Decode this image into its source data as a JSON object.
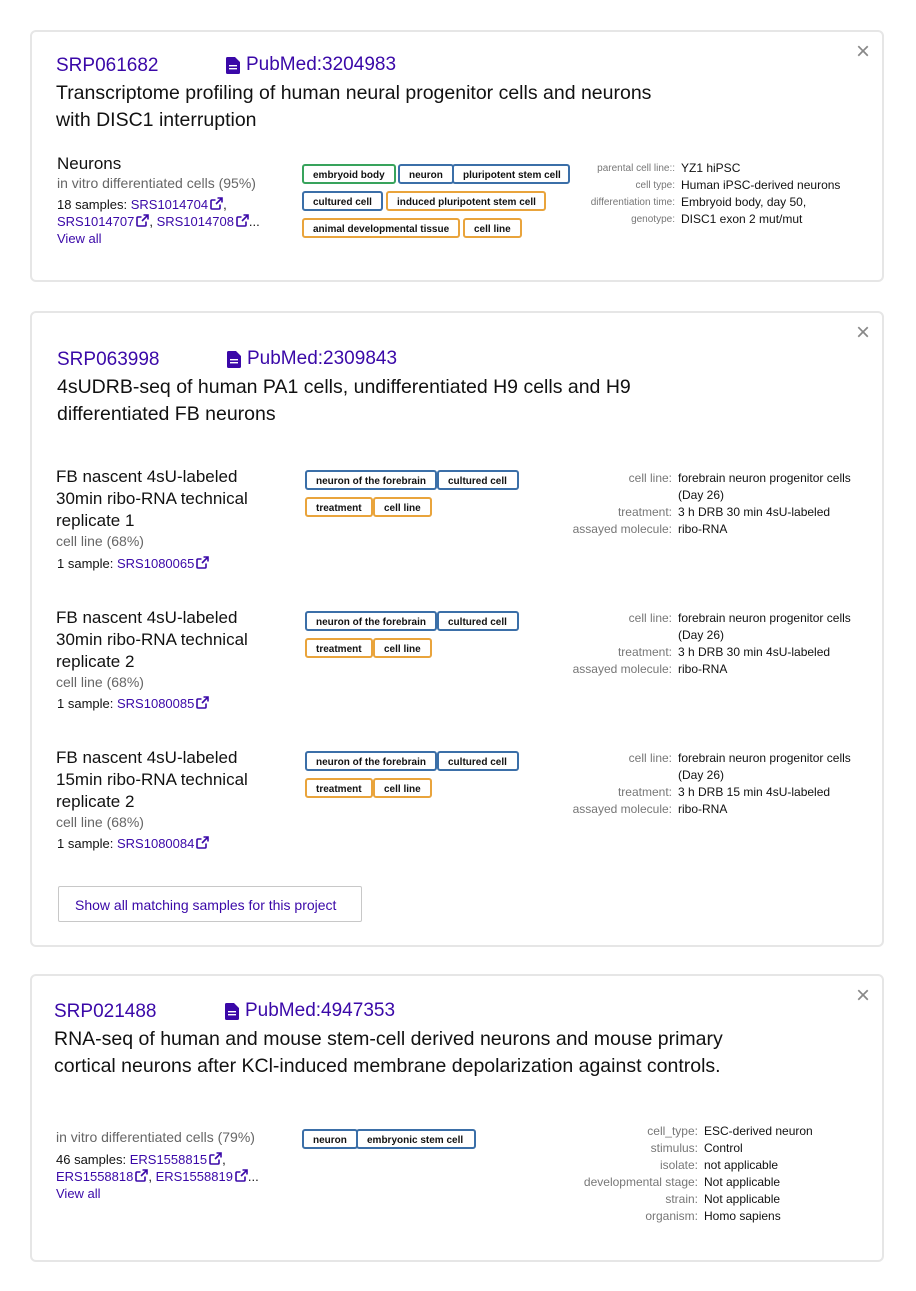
{
  "projects": [
    {
      "accession": "SRP061682",
      "pubmed": "PubMed:3204983",
      "title_line1": "Transcriptome profiling of human neural progenitor cells and neurons",
      "title_line2": "with DISC1 interruption",
      "groups": [
        {
          "name": "Neurons",
          "subtitle": "in vitro differentiated cells (95%)",
          "samples_label": "18 samples:",
          "samples": [
            "SRS1014704",
            "SRS1014707",
            "SRS1014708"
          ],
          "ellipsis": "...",
          "view_all": "View all",
          "tags": [
            {
              "label": "embryoid body",
              "color": "green"
            },
            {
              "label": "neuron",
              "color": "blue"
            },
            {
              "label": "pluripotent stem cell",
              "color": "blue"
            },
            {
              "label": "cultured cell",
              "color": "blue"
            },
            {
              "label": "induced pluripotent stem cell",
              "color": "orange"
            },
            {
              "label": "animal developmental tissue",
              "color": "orange"
            },
            {
              "label": "cell line",
              "color": "orange"
            }
          ],
          "attributes": [
            {
              "key": "parental cell line::",
              "value": "YZ1 hiPSC"
            },
            {
              "key": "cell type:",
              "value": "Human iPSC-derived neurons"
            },
            {
              "key": "differentiation time:",
              "value": "Embryoid body, day 50,"
            },
            {
              "key": "genotype:",
              "value": "DISC1 exon 2 mut/mut"
            }
          ]
        }
      ]
    },
    {
      "accession": "SRP063998",
      "pubmed": "PubMed:2309843",
      "title_line1": "4sUDRB-seq of human PA1 cells, undifferentiated H9 cells and H9",
      "title_line2": "differentiated FB neurons",
      "groups": [
        {
          "name_lines": [
            "FB nascent 4sU-labeled",
            "30min ribo-RNA technical",
            "replicate 1"
          ],
          "subtitle": "cell line (68%)",
          "samples_label": "1 sample:",
          "samples": [
            "SRS1080065"
          ],
          "tags": [
            {
              "label": "neuron of the forebrain",
              "color": "blue"
            },
            {
              "label": "cultured cell",
              "color": "blue"
            },
            {
              "label": "treatment",
              "color": "orange"
            },
            {
              "label": "cell line",
              "color": "orange"
            }
          ],
          "attributes": [
            {
              "key": "cell line:",
              "value": "forebrain neuron progenitor cells",
              "value2": "(Day 26)"
            },
            {
              "key": "treatment:",
              "value": "3 h DRB 30 min 4sU-labeled"
            },
            {
              "key": "assayed molecule:",
              "value": "ribo-RNA"
            }
          ]
        },
        {
          "name_lines": [
            "FB nascent 4sU-labeled",
            "30min ribo-RNA technical",
            "replicate 2"
          ],
          "subtitle": "cell line (68%)",
          "samples_label": "1 sample:",
          "samples": [
            "SRS1080085"
          ],
          "tags": [
            {
              "label": "neuron of the forebrain",
              "color": "blue"
            },
            {
              "label": "cultured cell",
              "color": "blue"
            },
            {
              "label": "treatment",
              "color": "orange"
            },
            {
              "label": "cell line",
              "color": "orange"
            }
          ],
          "attributes": [
            {
              "key": "cell line:",
              "value": "forebrain neuron progenitor cells",
              "value2": "(Day 26)"
            },
            {
              "key": "treatment:",
              "value": "3 h DRB 30 min 4sU-labeled"
            },
            {
              "key": "assayed molecule:",
              "value": "ribo-RNA"
            }
          ]
        },
        {
          "name_lines": [
            "FB nascent 4sU-labeled",
            "15min ribo-RNA technical",
            "replicate 2"
          ],
          "subtitle": "cell line (68%)",
          "samples_label": "1 sample:",
          "samples": [
            "SRS1080084"
          ],
          "tags": [
            {
              "label": "neuron of the forebrain",
              "color": "blue"
            },
            {
              "label": "cultured cell",
              "color": "blue"
            },
            {
              "label": "treatment",
              "color": "orange"
            },
            {
              "label": "cell line",
              "color": "orange"
            }
          ],
          "attributes": [
            {
              "key": "cell line:",
              "value": "forebrain neuron progenitor cells",
              "value2": "(Day 26)"
            },
            {
              "key": "treatment:",
              "value": "3 h DRB 15 min 4sU-labeled"
            },
            {
              "key": "assayed molecule:",
              "value": "ribo-RNA"
            }
          ]
        }
      ],
      "show_all_button": "Show all matching samples for this project"
    },
    {
      "accession": "SRP021488",
      "pubmed": "PubMed:4947353",
      "title_line1": "RNA-seq of human and mouse stem-cell derived neurons and mouse primary",
      "title_line2": "cortical neurons after KCl-induced membrane depolarization against controls.",
      "groups": [
        {
          "subtitle": "in vitro differentiated cells (79%)",
          "samples_label": "46 samples:",
          "samples": [
            "ERS1558815",
            "ERS1558818",
            "ERS1558819"
          ],
          "ellipsis": "...",
          "view_all": "View all",
          "tags": [
            {
              "label": "neuron",
              "color": "blue"
            },
            {
              "label": "embryonic stem cell",
              "color": "blue"
            }
          ],
          "attributes": [
            {
              "key": "cell_type:",
              "value": "ESC-derived neuron"
            },
            {
              "key": "stimulus:",
              "value": "Control"
            },
            {
              "key": "isolate:",
              "value": "not applicable"
            },
            {
              "key": "developmental stage:",
              "value": "Not applicable"
            },
            {
              "key": "strain:",
              "value": "Not applicable"
            },
            {
              "key": "organism:",
              "value": "Homo sapiens"
            }
          ]
        }
      ]
    }
  ],
  "icons": {
    "close": "close-icon",
    "doc": "document-icon",
    "external": "external-link-icon"
  },
  "close_glyph": "×"
}
